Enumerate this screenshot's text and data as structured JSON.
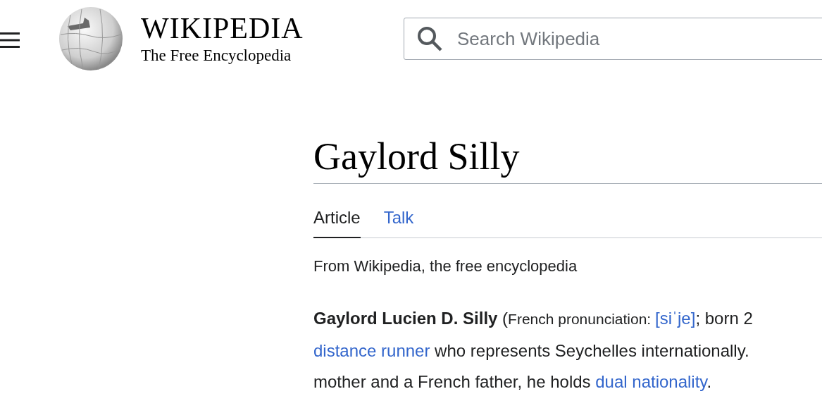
{
  "header": {
    "wordmark": "WIKIPEDIA",
    "tagline": "The Free Encyclopedia",
    "search": {
      "placeholder": "Search Wikipedia"
    }
  },
  "title": "Gaylord Silly",
  "tabs": [
    {
      "label": "Article",
      "selected": true
    },
    {
      "label": "Talk",
      "selected": false
    }
  ],
  "subtitle": "From Wikipedia, the free encyclopedia",
  "lines": [
    [
      {
        "kind": "bold",
        "text": "Gaylord Lucien D. Silly"
      },
      {
        "kind": "text",
        "text": " ("
      },
      {
        "kind": "small",
        "text": "French pronunciation: "
      },
      {
        "kind": "link",
        "text": "[siˈje]"
      },
      {
        "kind": "text",
        "text": "; born 2"
      }
    ],
    [
      {
        "kind": "link",
        "text": "distance runner"
      },
      {
        "kind": "text",
        "text": " who represents Seychelles internationally."
      }
    ],
    [
      {
        "kind": "text",
        "text": "mother and a French father, he holds "
      },
      {
        "kind": "link",
        "text": "dual nationality"
      },
      {
        "kind": "text",
        "text": "."
      }
    ]
  ]
}
